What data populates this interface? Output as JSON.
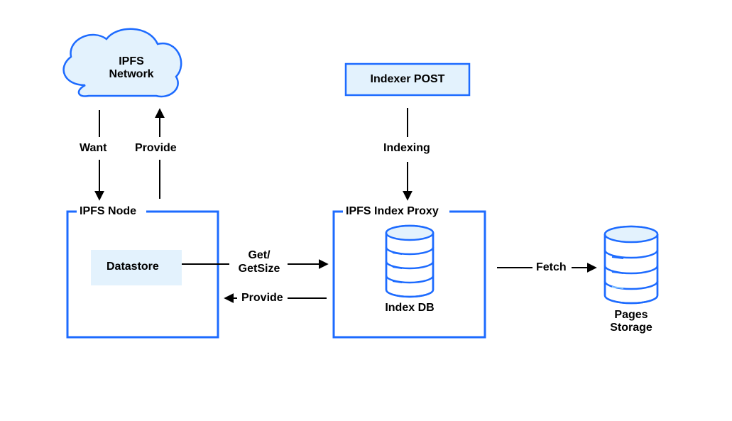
{
  "colors": {
    "stroke_blue": "#1D6BFF",
    "fill_blue": "#E3F2FD",
    "black": "#000000"
  },
  "nodes": {
    "ipfs_network": {
      "label_line1": "IPFS",
      "label_line2": "Network"
    },
    "ipfs_node": {
      "title": "IPFS Node",
      "datastore": "Datastore"
    },
    "indexer_post": {
      "label": "Indexer POST"
    },
    "ipfs_index_proxy": {
      "title": "IPFS Index Proxy",
      "db_label": "Index DB"
    },
    "pages_storage": {
      "label_line1": "Pages",
      "label_line2": "Storage"
    }
  },
  "edges": {
    "want": "Want",
    "provide_up": "Provide",
    "indexing": "Indexing",
    "get_getsize_line1": "Get/",
    "get_getsize_line2": "GetSize",
    "provide_left": "Provide",
    "fetch": "Fetch"
  }
}
